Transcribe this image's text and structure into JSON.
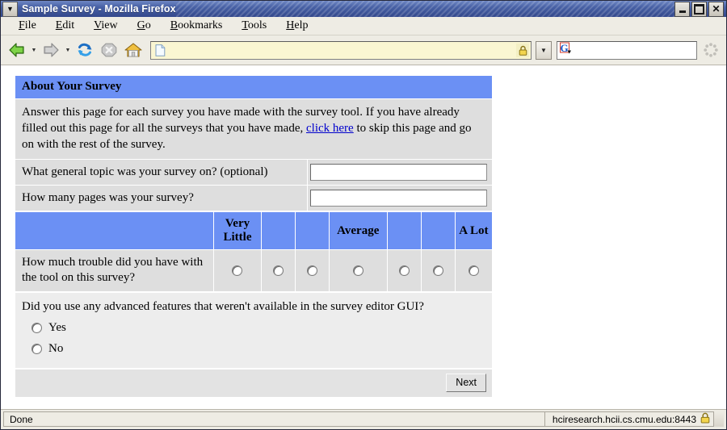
{
  "window": {
    "title": "Sample Survey - Mozilla Firefox",
    "system_menu_icon": "chevron-down-icon",
    "minimize_label": "Minimize",
    "maximize_label": "Maximize",
    "close_label": "Close"
  },
  "menubar": {
    "items": [
      {
        "label": "File",
        "accel": "F"
      },
      {
        "label": "Edit",
        "accel": "E"
      },
      {
        "label": "View",
        "accel": "V"
      },
      {
        "label": "Go",
        "accel": "G"
      },
      {
        "label": "Bookmarks",
        "accel": "B"
      },
      {
        "label": "Tools",
        "accel": "T"
      },
      {
        "label": "Help",
        "accel": "H"
      }
    ]
  },
  "toolbar": {
    "back": "back-arrow-icon",
    "forward": "forward-arrow-icon",
    "reload": "reload-icon",
    "stop": "stop-icon",
    "home": "home-icon",
    "url_value": "",
    "url_placeholder": "",
    "favicon": "document-icon",
    "lock": "padlock-icon",
    "dropdown": "chevron-down-icon",
    "search_engine": "G",
    "search_value": "",
    "search_placeholder": "",
    "throbber": "throbber-icon"
  },
  "page": {
    "section_title": "About Your Survey",
    "intro": {
      "before_link": "Answer this page for each survey you have made with the survey tool. If you have already filled out this page for all the surveys that you have made, ",
      "link_text": "click here",
      "after_link": " to skip this page and go on with the rest of the survey."
    },
    "questions": [
      {
        "label": "What general topic was your survey on? (optional)",
        "value": "",
        "placeholder": ""
      },
      {
        "label": "How many pages was your survey?",
        "value": "",
        "placeholder": ""
      }
    ],
    "matrix": {
      "scale_headers": [
        "Very Little",
        "",
        "",
        "Average",
        "",
        "",
        "A Lot"
      ],
      "row_label": "How much trouble did you have with the tool on this survey?",
      "options_count": 7,
      "selected_index": null
    },
    "freeform": {
      "question": "Did you use any advanced features that weren't available in the survey editor GUI?",
      "options": [
        {
          "label": "Yes",
          "selected": false
        },
        {
          "label": "No",
          "selected": false
        }
      ]
    },
    "next_button": "Next"
  },
  "statusbar": {
    "status": "Done",
    "host": "hciresearch.hcii.cs.cmu.edu:8443",
    "lock_icon": "padlock-icon"
  },
  "colors": {
    "accent_blue": "#6b90f4",
    "row_grey": "#dedede",
    "chrome": "#eeece4",
    "title_blue": "#4760a4",
    "link": "#0000cc",
    "url_bar": "#faf6d2"
  }
}
